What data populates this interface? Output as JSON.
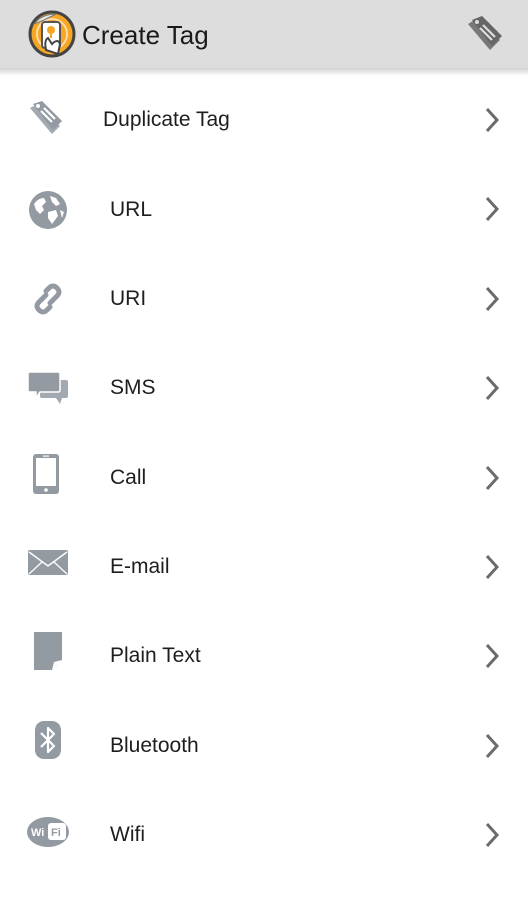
{
  "header": {
    "title": "Create Tag",
    "logo_icon": "app-logo-hand-tag-icon",
    "action_icon": "tag-icon"
  },
  "colors": {
    "action_bar_bg": "#dddddd",
    "icon_gray": "#939aa2",
    "chevron_gray": "#6b6b6b",
    "logo_orange": "#f5a623"
  },
  "menu": {
    "items": [
      {
        "label": "Duplicate Tag",
        "icon": "tag-icon"
      },
      {
        "label": "URL",
        "icon": "globe-icon"
      },
      {
        "label": "URI",
        "icon": "link-icon"
      },
      {
        "label": "SMS",
        "icon": "chat-bubbles-icon"
      },
      {
        "label": "Call",
        "icon": "phone-icon"
      },
      {
        "label": "E-mail",
        "icon": "envelope-icon"
      },
      {
        "label": "Plain Text",
        "icon": "document-icon"
      },
      {
        "label": "Bluetooth",
        "icon": "bluetooth-icon"
      },
      {
        "label": "Wifi",
        "icon": "wifi-icon"
      }
    ]
  }
}
